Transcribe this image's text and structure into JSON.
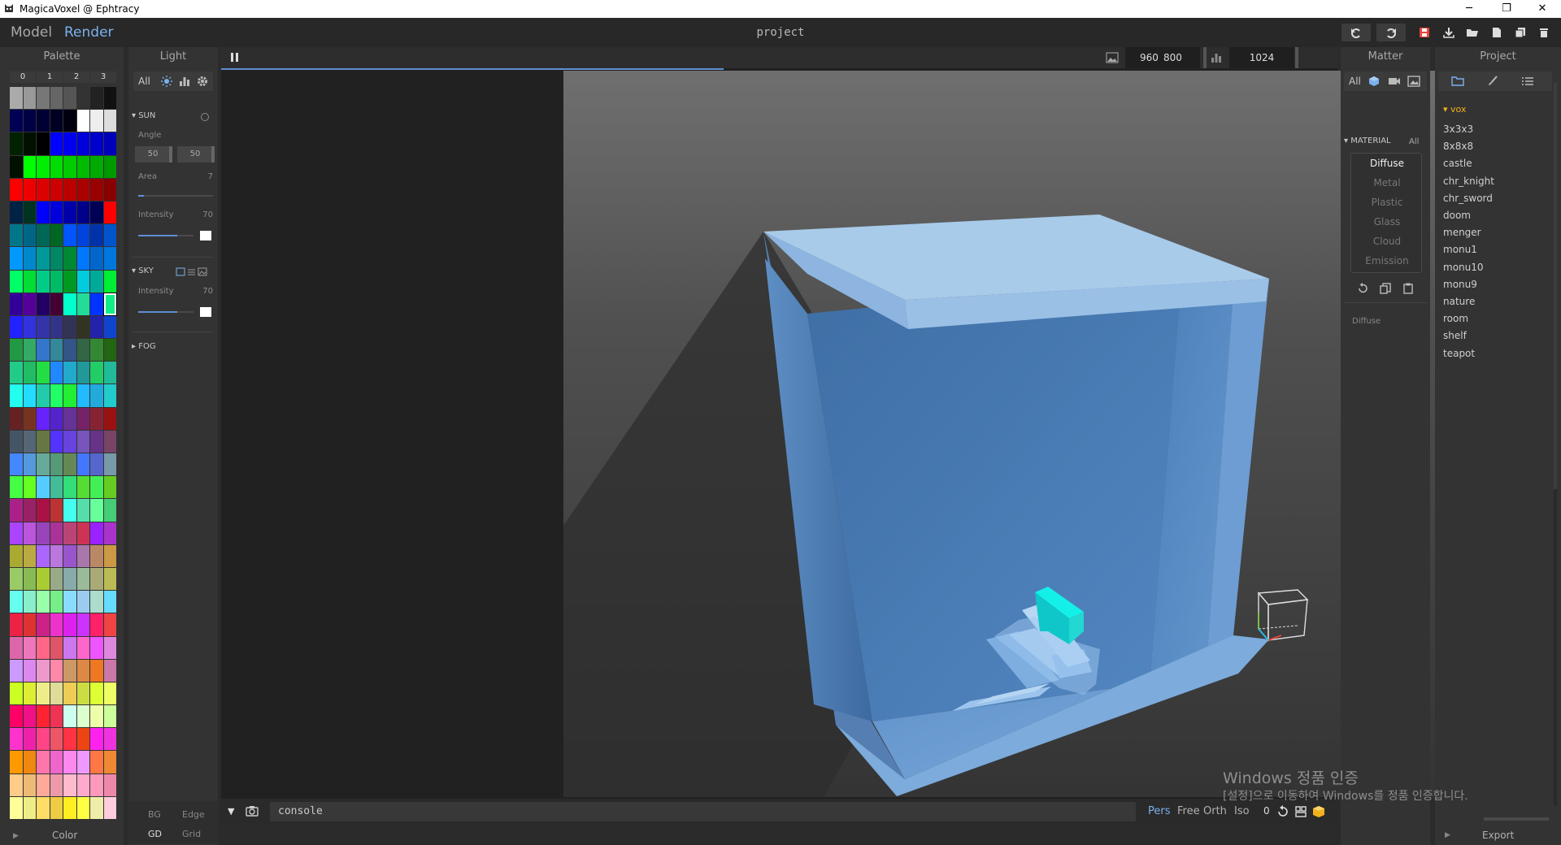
{
  "window": {
    "title": "MagicaVoxel @ Ephtracy",
    "controls": [
      "─",
      "❐",
      "✕"
    ]
  },
  "menu": {
    "model_label": "Model",
    "render_label": "Render",
    "project_title": "project"
  },
  "palette": {
    "header": "Palette",
    "tabs": [
      "0",
      "1",
      "2",
      "3"
    ],
    "footer_label": "Color",
    "bottom_buttons": [
      "BG",
      "Edge",
      "GD",
      "Grid"
    ],
    "colors": [
      "#aaaaaa",
      "#999999",
      "#777777",
      "#666666",
      "#555555",
      "#333333",
      "#222222",
      "#111111",
      "#000055",
      "#000044",
      "#000033",
      "#000022",
      "#000011",
      "#ffffff",
      "#eeeeee",
      "#dddddd",
      "#002200",
      "#001100",
      "#000000",
      "#0000ff",
      "#0000ee",
      "#0000dd",
      "#0000cc",
      "#0000bb",
      "#001100",
      "#00ff00",
      "#00ee00",
      "#00dd00",
      "#00cc00",
      "#00bb00",
      "#00aa00",
      "#009900",
      "#ff0000",
      "#ee0000",
      "#dd0000",
      "#cc0000",
      "#bb0000",
      "#aa0000",
      "#990000",
      "#880000",
      "#002244",
      "#003322",
      "#0000ff",
      "#0000dd",
      "#0000aa",
      "#000088",
      "#000055",
      "#ff0000",
      "#007788",
      "#006688",
      "#006655",
      "#006622",
      "#0055ff",
      "#0044dd",
      "#0033aa",
      "#0055cc",
      "#0099ff",
      "#0088cc",
      "#009999",
      "#008866",
      "#008833",
      "#0077ff",
      "#0066cc",
      "#0077dd",
      "#00ff66",
      "#00dd33",
      "#00cc88",
      "#00bb66",
      "#009922",
      "#00ccdd",
      "#00aa99",
      "#00ee33",
      "#330099",
      "#550099",
      "#220066",
      "#440033",
      "#00ffcc",
      "#22dd99",
      "#0033ff",
      "#11ee88",
      "#2222ff",
      "#3333dd",
      "#3333aa",
      "#333388",
      "#333355",
      "#333322",
      "#2222aa",
      "#1144cc",
      "#229944",
      "#33aa66",
      "#3377cc",
      "#338899",
      "#335588",
      "#336644",
      "#338833",
      "#226611",
      "#22cc88",
      "#22bb66",
      "#22dd44",
      "#2288ff",
      "#22aacc",
      "#229999",
      "#22cc66",
      "#22bb99",
      "#22ffee",
      "#22ddff",
      "#22ccaa",
      "#22ff66",
      "#22ee33",
      "#22bbff",
      "#22aadd",
      "#22cccc",
      "#662222",
      "#773322",
      "#6622ff",
      "#5522cc",
      "#663399",
      "#772266",
      "#882233",
      "#991111",
      "#445566",
      "#556677",
      "#667744",
      "#5533ff",
      "#6644dd",
      "#7755bb",
      "#663388",
      "#774466",
      "#4488ff",
      "#5599dd",
      "#66aa99",
      "#559977",
      "#668855",
      "#4477ff",
      "#5566cc",
      "#7799aa",
      "#44ff44",
      "#66ff22",
      "#55ccff",
      "#44bb99",
      "#33dd77",
      "#55dd33",
      "#44ee55",
      "#66cc22",
      "#aa2288",
      "#992266",
      "#aa1144",
      "#bb3333",
      "#44ffee",
      "#55ddaa",
      "#66ff99",
      "#44cc77",
      "#aa44ff",
      "#bb55dd",
      "#9944bb",
      "#aa3399",
      "#bb4477",
      "#cc3355",
      "#9922ff",
      "#aa33cc",
      "#aaaa33",
      "#bbaa44",
      "#aa66ff",
      "#bb77dd",
      "#9955cc",
      "#aa77aa",
      "#bb8866",
      "#cc9944",
      "#99cc66",
      "#88bb55",
      "#aacc33",
      "#99aa88",
      "#88aaaa",
      "#99bb99",
      "#aaaa77",
      "#bbbb55",
      "#66ffee",
      "#88eecc",
      "#99ffaa",
      "#77ee88",
      "#88ddff",
      "#99ccee",
      "#aaddcc",
      "#66ddff",
      "#ee2244",
      "#dd3333",
      "#cc2288",
      "#ee33cc",
      "#dd22ee",
      "#cc33ff",
      "#ff2266",
      "#ee4444",
      "#dd66aa",
      "#ee77bb",
      "#ff6688",
      "#dd5566",
      "#cc77ee",
      "#ff66cc",
      "#ee55ff",
      "#dd88dd",
      "#cc99ff",
      "#dd88ee",
      "#ee99cc",
      "#ff88aa",
      "#cc9966",
      "#dd8844",
      "#ee7722",
      "#cc77aa",
      "#ccff22",
      "#ddee33",
      "#eeee88",
      "#dddd99",
      "#eecc55",
      "#ccdd44",
      "#ddff33",
      "#eeff66",
      "#ff0066",
      "#ee1188",
      "#ff2233",
      "#ee3355",
      "#ccffee",
      "#ddffcc",
      "#eeffaa",
      "#ccff99",
      "#ff33cc",
      "#ee22aa",
      "#ff4488",
      "#ee5566",
      "#ff3344",
      "#ee4411",
      "#ff22ee",
      "#ee33dd",
      "#ff9900",
      "#ee8811",
      "#ff77aa",
      "#ee66cc",
      "#ff88ee",
      "#ee99ff",
      "#ff7744",
      "#ee8833",
      "#ffcc88",
      "#eebb77",
      "#ffaa99",
      "#ee99aa",
      "#ffbbcc",
      "#ffaacc",
      "#ff99bb",
      "#ee88aa",
      "#ffff99",
      "#eeee88",
      "#ffdd66",
      "#eecc44",
      "#ffee22",
      "#ffff44",
      "#eeeeaa",
      "#ffccdd"
    ],
    "selected_index": 79
  },
  "light": {
    "header": "Light",
    "all_label": "All",
    "sun": {
      "label": "SUN",
      "angle_label": "Angle",
      "angle_x": "50",
      "angle_y": "50",
      "area_label": "Area",
      "area_value": "7",
      "area_level": 0.08,
      "intensity_label": "Intensity",
      "intensity_value": "70",
      "intensity_level": 0.7
    },
    "sky": {
      "label": "SKY",
      "intensity_label": "Intensity",
      "intensity_value": "70",
      "intensity_level": 0.7
    },
    "fog": {
      "label": "FOG"
    }
  },
  "viewport": {
    "resolution_w": "960",
    "resolution_h": "800",
    "sample_count": "1024",
    "progress": 0.45
  },
  "console": {
    "placeholder": "console",
    "view_modes": [
      "Pers",
      "Free",
      "Orth",
      "Iso"
    ],
    "active_view_mode": "Pers",
    "counter": "0"
  },
  "matter": {
    "header": "Matter",
    "all_label": "All",
    "material_label": "MATERIAL",
    "material_all": "All",
    "types": [
      "Diffuse",
      "Metal",
      "Plastic",
      "Glass",
      "Cloud",
      "Emission"
    ],
    "selected_type": "Diffuse",
    "info_label": "Diffuse"
  },
  "project": {
    "header": "Project",
    "folder": "vox",
    "items": [
      "3x3x3",
      "8x8x8",
      "castle",
      "chr_knight",
      "chr_sword",
      "doom",
      "menger",
      "monu1",
      "monu10",
      "monu9",
      "nature",
      "room",
      "shelf",
      "teapot"
    ],
    "export_label": "Export"
  },
  "watermark": {
    "line1": "Windows 정품 인증",
    "line2": "[설정]으로 이동하여 Windows를 정품 인증합니다."
  },
  "colors": {
    "accent": "#5e8fd4",
    "panel": "#333333",
    "object_blue": "#8fb8de",
    "cyan": "#00e0e0",
    "save_red": "#e8453c",
    "folder_yellow": "#f3b21c"
  }
}
